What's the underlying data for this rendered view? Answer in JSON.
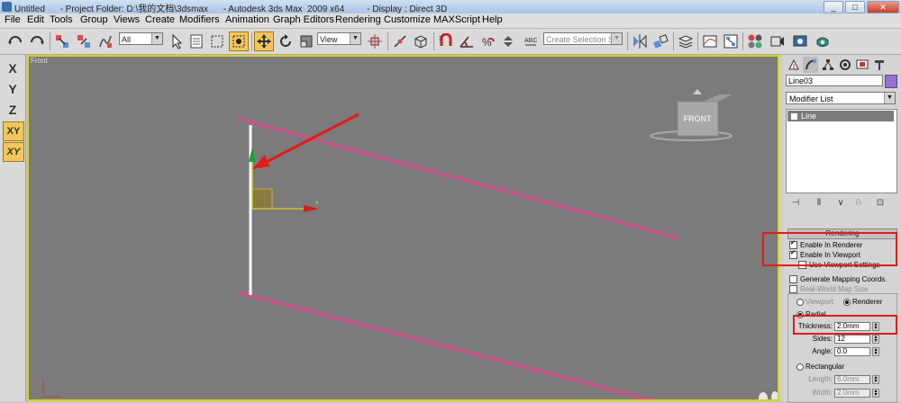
{
  "window": {
    "title": "Untitled      - Project Folder: D:\\我的文档\\3dsmax      - Autodesk 3ds Max  2009 x64         - Display : Direct 3D",
    "buttons": [
      "_",
      "□",
      "✕"
    ]
  },
  "menu": [
    "File",
    "Edit",
    "Tools",
    "Group",
    "Views",
    "Create",
    "Modifiers",
    "Animation",
    "Graph Editors",
    "Rendering",
    "Customize",
    "MAXScript",
    "Help"
  ],
  "toolbar": {
    "selection_filter": "All",
    "reference_coord": "View",
    "named_selection_placeholder": "Create Selection Set"
  },
  "axis_constraints": [
    "X",
    "Y",
    "Z",
    "XY",
    "XY"
  ],
  "viewport": {
    "label": "Front",
    "viewcube_label": "FRONT",
    "gizmo_x_label": "x"
  },
  "command_panel": {
    "object_name": "Line03",
    "object_color": "#9a6ed8",
    "modifier_list_label": "Modifier List",
    "stack_item": "Line",
    "rollout_title": "Rendering",
    "enable_in_renderer": "Enable In Renderer",
    "enable_in_viewport": "Enable In Viewport",
    "use_viewport_settings": "Use Viewport Settings",
    "generate_mapping": "Generate Mapping Coords.",
    "real_world_map": "Real-World Map Size",
    "viewport_radio": "Viewport",
    "renderer_radio": "Renderer",
    "radial_radio": "Radial",
    "thickness_label": "Thickness:",
    "thickness_value": "2.0mm",
    "sides_label": "Sides:",
    "sides_value": "12",
    "angle_label": "Angle:",
    "angle_value": "0.0",
    "rectangular_radio": "Rectangular",
    "length_label": "Length:",
    "length_value": "6.0mm",
    "width_label": "Width:",
    "width_value": "2.0mm"
  },
  "colors": {
    "viewport_bg": "#7b7b7b",
    "spline_pink": "#e0468f",
    "annotation_red": "#e31b1b",
    "viewport_border": "#d6d218",
    "active_button": "#f2c65a"
  }
}
